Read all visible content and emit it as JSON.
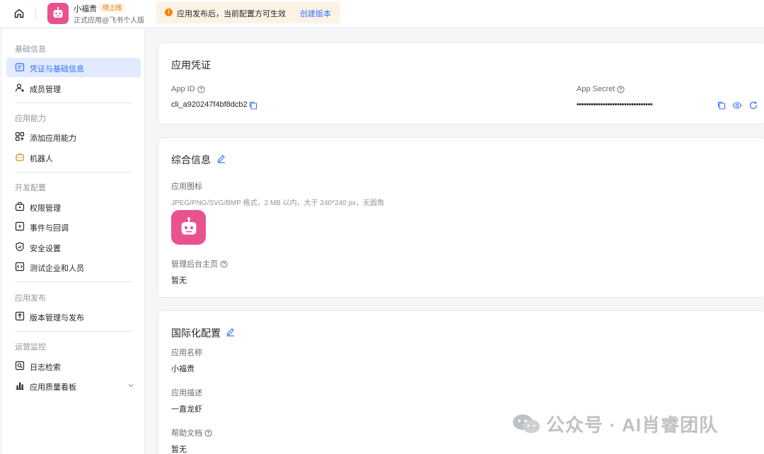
{
  "header": {
    "app_name": "小福贵",
    "app_badge": "待上线",
    "app_sub": "正式应用@飞书个人版",
    "notice_text": "应用发布后，当前配置方可生效",
    "notice_link": "创建版本",
    "notice_icon": "!"
  },
  "sidebar": {
    "sections": [
      {
        "title": "基础信息",
        "items": [
          {
            "label": "凭证与基础信息",
            "icon": "credential-icon",
            "active": true
          },
          {
            "label": "成员管理",
            "icon": "member-icon"
          }
        ]
      },
      {
        "title": "应用能力",
        "items": [
          {
            "label": "添加应用能力",
            "icon": "add-capability-icon"
          },
          {
            "label": "机器人",
            "icon": "robot-icon"
          }
        ]
      },
      {
        "title": "开发配置",
        "items": [
          {
            "label": "权限管理",
            "icon": "permission-icon"
          },
          {
            "label": "事件与回调",
            "icon": "event-icon"
          },
          {
            "label": "安全设置",
            "icon": "shield-icon"
          },
          {
            "label": "测试企业和人员",
            "icon": "code-icon"
          }
        ]
      },
      {
        "title": "应用发布",
        "items": [
          {
            "label": "版本管理与发布",
            "icon": "upload-icon"
          }
        ]
      },
      {
        "title": "运营监控",
        "items": [
          {
            "label": "日志检索",
            "icon": "log-search-icon"
          },
          {
            "label": "应用质量看板",
            "icon": "chart-icon"
          }
        ]
      }
    ]
  },
  "credentials": {
    "title": "应用凭证",
    "app_id_label": "App ID",
    "app_id_value": "cli_a920247f4bf8dcb2",
    "app_secret_label": "App Secret",
    "app_secret_value": "••••••••••••••••••••••••••••••••"
  },
  "general": {
    "title": "综合信息",
    "icon_label": "应用图标",
    "icon_hint": "JPEG/PNG/SVG/BMP 格式，2 MB 以内，大于 240*240 px，无圆角",
    "admin_label": "管理后台主页",
    "admin_value": "暂无"
  },
  "i18n": {
    "title": "国际化配置",
    "name_label": "应用名称",
    "name_value": "小福贵",
    "desc_label": "应用描述",
    "desc_value": "一直龙虾",
    "help_label": "帮助文档",
    "help_value": "暂无"
  },
  "watermark": {
    "text": "公众号 · AI肖睿团队"
  },
  "colors": {
    "accent": "#3370ff",
    "brand_pink": "#e9528f",
    "notice_bg": "#fdf3e5"
  }
}
